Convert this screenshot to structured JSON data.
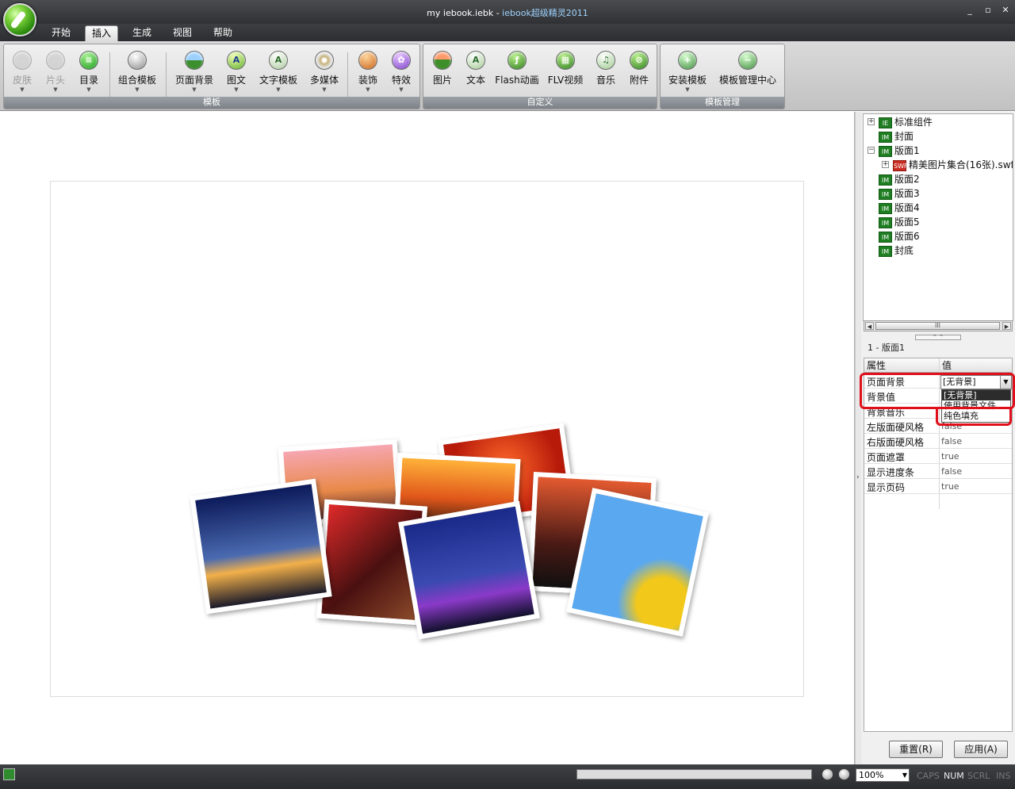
{
  "window": {
    "title_file": "my iebook.iebk - ",
    "title_app": "iebook超级精灵2011",
    "controls": [
      "_",
      "▫",
      "✕"
    ]
  },
  "tabs": [
    "开始",
    "插入",
    "生成",
    "视图",
    "帮助"
  ],
  "ribbon": {
    "groups": [
      {
        "label": "模板",
        "buttons": [
          "皮肤",
          "片头",
          "目录",
          "组合模板",
          "页面背景",
          "图文",
          "文字模板",
          "多媒体",
          "装饰",
          "特效"
        ]
      },
      {
        "label": "自定义",
        "buttons": [
          "图片",
          "文本",
          "Flash动画",
          "FLV视频",
          "音乐",
          "附件"
        ]
      },
      {
        "label": "模板管理",
        "buttons": [
          "安装模板",
          "模板管理中心"
        ]
      }
    ]
  },
  "tree": {
    "nodes": [
      "标准组件",
      "封面",
      "版面1",
      "精美图片集合(16张).swf",
      "版面2",
      "版面3",
      "版面4",
      "版面5",
      "版面6",
      "封底"
    ]
  },
  "props": {
    "title": "1 - 版面1",
    "header": {
      "name": "属性",
      "value": "值"
    },
    "rows": [
      {
        "name": "页面背景",
        "value": "[无背景]"
      },
      {
        "name": "背景值",
        "value": ""
      },
      {
        "name": "背景音乐",
        "value": ""
      },
      {
        "name": "左版面硬风格",
        "value": "false"
      },
      {
        "name": "右版面硬风格",
        "value": "false"
      },
      {
        "name": "页面遮罩",
        "value": "true"
      },
      {
        "name": "显示进度条",
        "value": "false"
      },
      {
        "name": "显示页码",
        "value": "true"
      }
    ],
    "dropdown_options": [
      "[无背景]",
      "使用背景文件",
      "纯色填充"
    ],
    "reset_label": "重置(R)",
    "apply_label": "应用(A)"
  },
  "status": {
    "zoom": "100%",
    "keys": [
      "CAPS",
      "NUM",
      "SCRL",
      "INS"
    ]
  },
  "colors": {
    "highlight": "#e0101a",
    "accent_green": "#2d8d0f"
  }
}
